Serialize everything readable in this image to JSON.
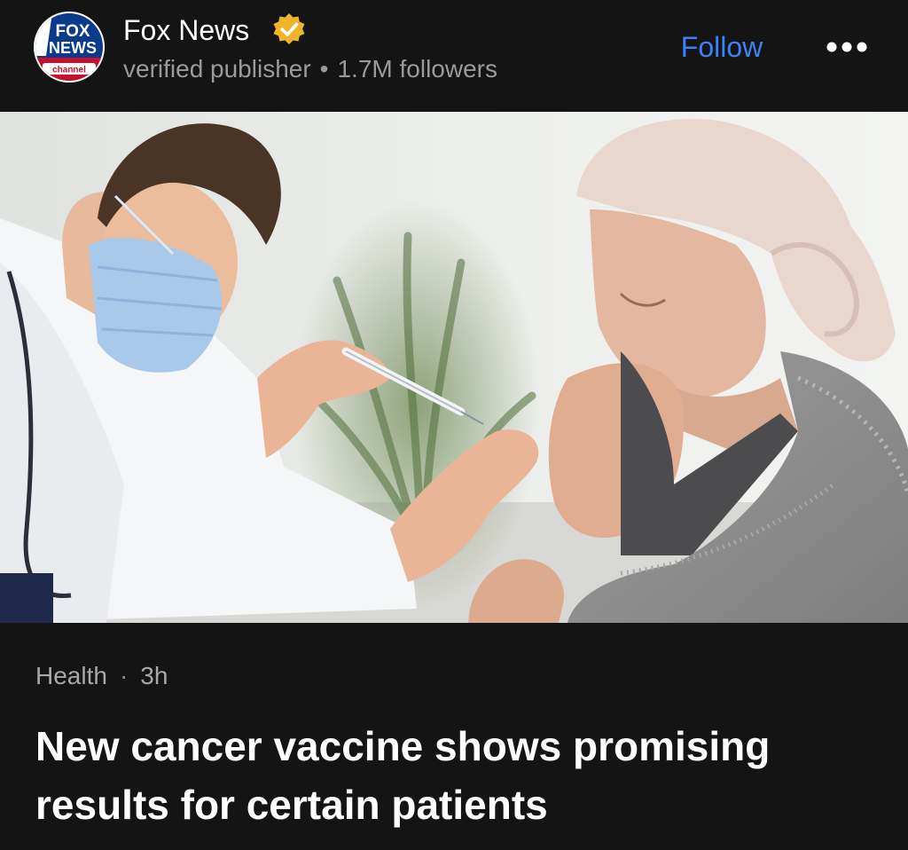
{
  "publisher": {
    "logo_text_top": "FOX",
    "logo_text_mid": "NEWS",
    "logo_text_bottom": "channel",
    "name": "Fox News",
    "meta_verified": "verified publisher",
    "meta_separator": "•",
    "meta_followers": "1.7M followers",
    "badge_icon": "verified-check-icon"
  },
  "actions": {
    "follow_label": "Follow",
    "more_icon": "more-horizontal-icon"
  },
  "hero": {
    "image_description_icon": "article-photo"
  },
  "article": {
    "category": "Health",
    "separator": "·",
    "age": "3h",
    "headline": "New cancer vaccine shows promising results for certain patients"
  },
  "colors": {
    "background": "#141414",
    "accent_blue": "#3b82f6",
    "badge_gold": "#f0b429",
    "muted_text": "#9a9a9a"
  }
}
